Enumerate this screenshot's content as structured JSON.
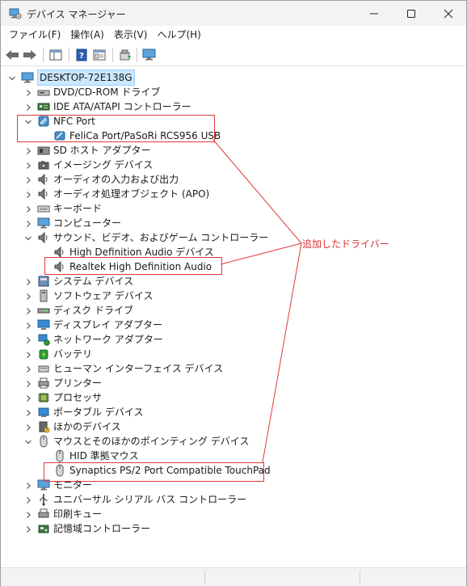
{
  "window": {
    "title": "デバイス マネージャー"
  },
  "menu": [
    "ファイル(F)",
    "操作(A)",
    "表示(V)",
    "ヘルプ(H)"
  ],
  "tree": {
    "root": "DESKTOP-72E138G",
    "categories": [
      {
        "label": "DVD/CD-ROM ドライブ",
        "icon": "dvd-drive-icon",
        "expanded": false
      },
      {
        "label": "IDE ATA/ATAPI コントローラー",
        "icon": "ide-controller-icon",
        "expanded": false
      },
      {
        "label": "NFC Port",
        "icon": "nfc-icon",
        "expanded": true,
        "children": [
          "FeliCa Port/PaSoRi RCS956 USB"
        ]
      },
      {
        "label": "SD ホスト アダプター",
        "icon": "sd-host-icon",
        "expanded": false
      },
      {
        "label": "イメージング デバイス",
        "icon": "camera-icon",
        "expanded": false
      },
      {
        "label": "オーディオの入力および出力",
        "icon": "speaker-icon",
        "expanded": false
      },
      {
        "label": "オーディオ処理オブジェクト (APO)",
        "icon": "speaker-icon",
        "expanded": false
      },
      {
        "label": "キーボード",
        "icon": "keyboard-icon",
        "expanded": false
      },
      {
        "label": "コンピューター",
        "icon": "monitor-icon",
        "expanded": false
      },
      {
        "label": "サウンド、ビデオ、およびゲーム コントローラー",
        "icon": "speaker-icon",
        "expanded": true,
        "children": [
          "High Definition Audio デバイス",
          "Realtek High Definition Audio"
        ]
      },
      {
        "label": "システム デバイス",
        "icon": "system-device-icon",
        "expanded": false
      },
      {
        "label": "ソフトウェア デバイス",
        "icon": "software-device-icon",
        "expanded": false
      },
      {
        "label": "ディスク ドライブ",
        "icon": "disk-drive-icon",
        "expanded": false
      },
      {
        "label": "ディスプレイ アダプター",
        "icon": "display-adapter-icon",
        "expanded": false
      },
      {
        "label": "ネットワーク アダプター",
        "icon": "network-adapter-icon",
        "expanded": false
      },
      {
        "label": "バッテリ",
        "icon": "battery-icon",
        "expanded": false
      },
      {
        "label": "ヒューマン インターフェイス デバイス",
        "icon": "hid-icon",
        "expanded": false
      },
      {
        "label": "プリンター",
        "icon": "printer-icon",
        "expanded": false
      },
      {
        "label": "プロセッサ",
        "icon": "processor-icon",
        "expanded": false
      },
      {
        "label": "ポータブル デバイス",
        "icon": "portable-device-icon",
        "expanded": false
      },
      {
        "label": "ほかのデバイス",
        "icon": "other-device-icon",
        "expanded": false
      },
      {
        "label": "マウスとそのほかのポインティング デバイス",
        "icon": "mouse-icon",
        "expanded": true,
        "children": [
          "HID 準拠マウス",
          "Synaptics PS/2 Port Compatible TouchPad"
        ]
      },
      {
        "label": "モニター",
        "icon": "monitor-icon",
        "expanded": false
      },
      {
        "label": "ユニバーサル シリアル バス コントローラー",
        "icon": "usb-icon",
        "expanded": false
      },
      {
        "label": "印刷キュー",
        "icon": "print-queue-icon",
        "expanded": false
      },
      {
        "label": "記憶域コントローラー",
        "icon": "storage-controller-icon",
        "expanded": false
      }
    ]
  },
  "annotation": {
    "label": "追加したドライバー",
    "color": "#d83232"
  }
}
